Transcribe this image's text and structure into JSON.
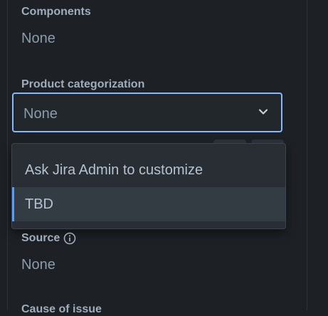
{
  "fields": {
    "components": {
      "label": "Components",
      "value": "None"
    },
    "product_categorization": {
      "label": "Product categorization",
      "value": "None",
      "options": [
        {
          "label": "Ask Jira Admin to customize",
          "selected": false
        },
        {
          "label": "TBD",
          "selected": true
        }
      ]
    },
    "source": {
      "label": "Source",
      "value": "None",
      "info_icon": "info-icon"
    },
    "cause_of_issue": {
      "label": "Cause of issue"
    }
  },
  "colors": {
    "background": "#1d2125",
    "focus_border": "#85b8ff",
    "selected_indicator": "#579dff",
    "label_text": "#9fadbc",
    "value_text": "#8c9bab"
  }
}
